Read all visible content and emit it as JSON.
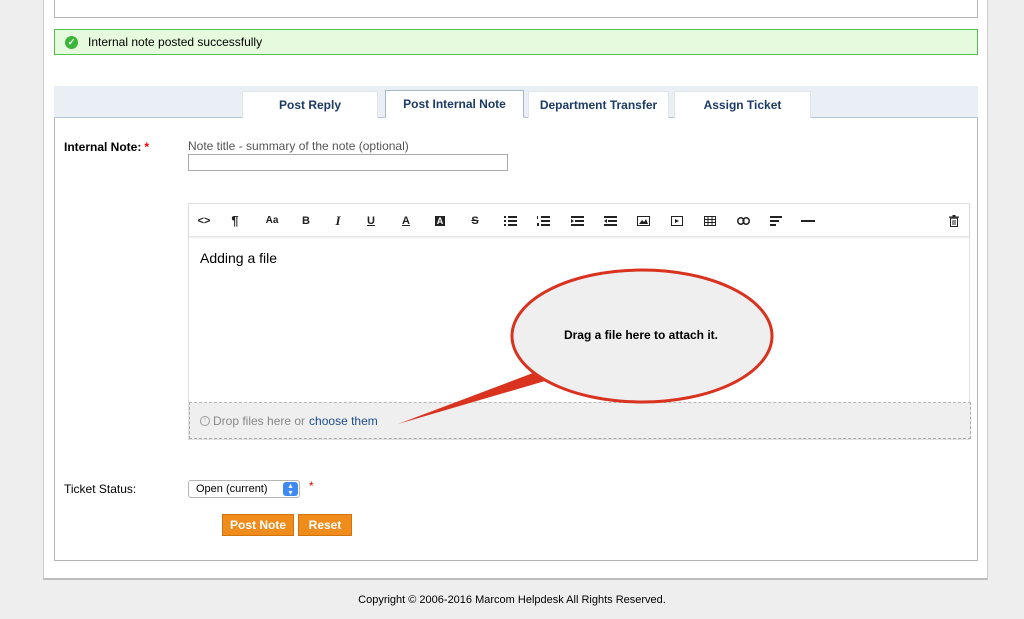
{
  "notice": {
    "message": "Internal note posted successfully",
    "color": "#53c34f"
  },
  "tabs": [
    {
      "label": "Post Reply"
    },
    {
      "label": "Post Internal Note",
      "active": true
    },
    {
      "label": "Department Transfer"
    },
    {
      "label": "Assign Ticket"
    }
  ],
  "form": {
    "note_label": "Internal Note:",
    "required_mark": "*",
    "title_hint": "Note title - summary of the note (optional)",
    "title_value": "",
    "editor_text": "Adding a file",
    "toolbar": [
      "code-view-icon",
      "paragraph-icon",
      "font-size-icon",
      "bold-icon",
      "italic-icon",
      "underline-icon",
      "text-color-icon",
      "background-color-icon",
      "strikethrough-icon",
      "bullet-list-icon",
      "numbered-list-icon",
      "outdent-icon",
      "indent-icon",
      "image-icon",
      "video-icon",
      "table-icon",
      "link-icon",
      "align-icon",
      "horizontal-rule-icon",
      "trash-icon"
    ],
    "toolbar_glyphs": {
      "code": "<>",
      "paragraph": "¶",
      "font": "Aa",
      "bold": "B",
      "italic": "I",
      "underline": "U",
      "color": "A",
      "bgcolor": "A",
      "strike": "S"
    },
    "drop_text": "Drop files here or",
    "drop_link": "choose them",
    "status_label": "Ticket Status:",
    "status_value": "Open (current)",
    "post_button": "Post Note",
    "reset_button": "Reset"
  },
  "callout": {
    "text": "Drag a file here to attach it.",
    "stroke": "#d9321f"
  },
  "footer": "Copyright © 2006-2016 Marcom Helpdesk All Rights Reserved."
}
